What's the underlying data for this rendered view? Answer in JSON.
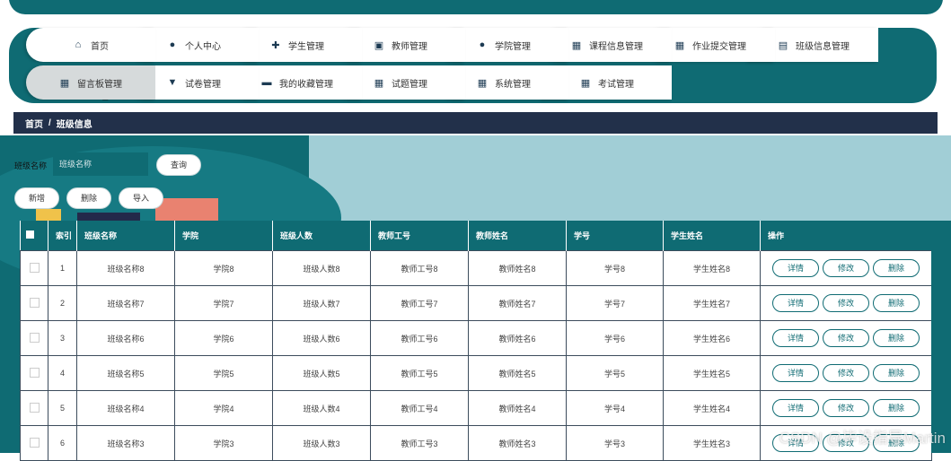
{
  "nav": {
    "row1": [
      {
        "label": "首页",
        "icon": "home-icon",
        "glyph": "⌂"
      },
      {
        "label": "个人中心",
        "icon": "user-icon",
        "glyph": "●"
      },
      {
        "label": "学生管理",
        "icon": "student-icon",
        "glyph": "✚"
      },
      {
        "label": "教师管理",
        "icon": "briefcase-icon",
        "glyph": "▣"
      },
      {
        "label": "学院管理",
        "icon": "user-icon",
        "glyph": "●"
      },
      {
        "label": "课程信息管理",
        "icon": "grid-icon",
        "glyph": "▦"
      },
      {
        "label": "作业提交管理",
        "icon": "grid-icon",
        "glyph": "▦"
      },
      {
        "label": "班级信息管理",
        "icon": "clipboard-icon",
        "glyph": "▤"
      }
    ],
    "row2": [
      {
        "label": "留言板管理",
        "icon": "grid-icon",
        "glyph": "▦"
      },
      {
        "label": "试卷管理",
        "icon": "brush-icon",
        "glyph": "▼"
      },
      {
        "label": "我的收藏管理",
        "icon": "comment-icon",
        "glyph": "▬"
      },
      {
        "label": "试题管理",
        "icon": "grid-icon",
        "glyph": "▦"
      },
      {
        "label": "系统管理",
        "icon": "grid-icon",
        "glyph": "▦"
      },
      {
        "label": "考试管理",
        "icon": "grid-icon",
        "glyph": "▦"
      }
    ]
  },
  "breadcrumb": {
    "home": "首页",
    "sep": "/",
    "current": "班级信息"
  },
  "search": {
    "label": "班级名称",
    "placeholder": "班级名称",
    "button": "查询"
  },
  "actions": {
    "add": "新增",
    "delete": "删除",
    "import": "导入"
  },
  "table": {
    "headers": [
      "",
      "索引",
      "班级名称",
      "学院",
      "班级人数",
      "教师工号",
      "教师姓名",
      "学号",
      "学生姓名",
      "操作"
    ],
    "ops": {
      "detail": "详情",
      "edit": "修改",
      "delete": "删除"
    },
    "rows": [
      {
        "idx": "1",
        "name": "班级名称8",
        "college": "学院8",
        "count": "班级人数8",
        "tno": "教师工号8",
        "tname": "教师姓名8",
        "sno": "学号8",
        "sname": "学生姓名8"
      },
      {
        "idx": "2",
        "name": "班级名称7",
        "college": "学院7",
        "count": "班级人数7",
        "tno": "教师工号7",
        "tname": "教师姓名7",
        "sno": "学号7",
        "sname": "学生姓名7"
      },
      {
        "idx": "3",
        "name": "班级名称6",
        "college": "学院6",
        "count": "班级人数6",
        "tno": "教师工号6",
        "tname": "教师姓名6",
        "sno": "学号6",
        "sname": "学生姓名6"
      },
      {
        "idx": "4",
        "name": "班级名称5",
        "college": "学院5",
        "count": "班级人数5",
        "tno": "教师工号5",
        "tname": "教师姓名5",
        "sno": "学号5",
        "sname": "学生姓名5"
      },
      {
        "idx": "5",
        "name": "班级名称4",
        "college": "学院4",
        "count": "班级人数4",
        "tno": "教师工号4",
        "tname": "教师姓名4",
        "sno": "学号4",
        "sname": "学生姓名4"
      },
      {
        "idx": "6",
        "name": "班级名称3",
        "college": "学院3",
        "count": "班级人数3",
        "tno": "教师工号3",
        "tname": "教师姓名3",
        "sno": "学号3",
        "sname": "学生姓名3"
      }
    ]
  },
  "watermark": "CSDN @毕设指导Martin"
}
